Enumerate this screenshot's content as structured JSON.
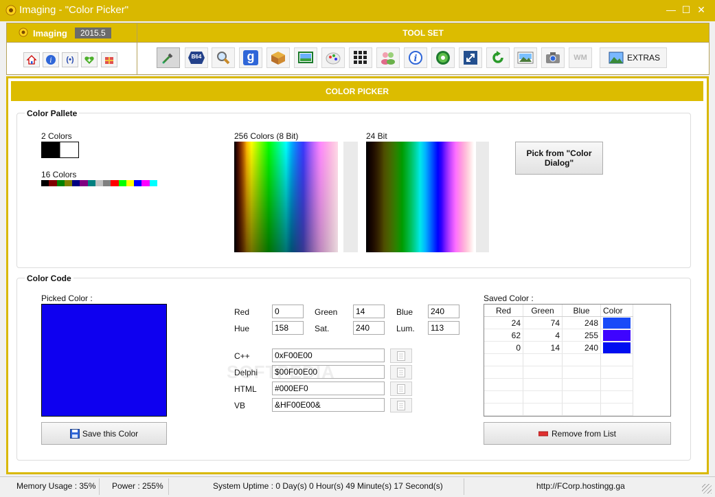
{
  "window": {
    "title": "Imaging - \"Color Picker\"",
    "controls": {
      "minimize": "—",
      "maximize": "☐",
      "close": "✕"
    }
  },
  "app": {
    "name": "Imaging",
    "version": "2015.5"
  },
  "toolset": {
    "title": "TOOL SET",
    "tools": [
      "eyedropper-icon",
      "base64-icon",
      "magnifier-icon",
      "google-icon",
      "box-icon",
      "images-icon",
      "paint-icon",
      "grid-icon",
      "people-icon",
      "info-icon",
      "gear-icon",
      "resize-icon",
      "refresh-icon",
      "picture-icon",
      "camera-icon",
      "watermark-icon"
    ],
    "b64_label": "B64",
    "g_label": "g",
    "wm_label": "WM",
    "extras_label": "EXTRAS"
  },
  "panel_title": "COLOR PICKER",
  "palette": {
    "group_label": "Color Pallete",
    "two_colors_label": "2 Colors",
    "sixteen_colors_label": "16 Colors",
    "sixteen_colors": [
      "#000000",
      "#800000",
      "#008000",
      "#808000",
      "#000080",
      "#800080",
      "#008080",
      "#c0c0c0",
      "#808080",
      "#ff0000",
      "#00ff00",
      "#ffff00",
      "#0000ff",
      "#ff00ff",
      "#00ffff",
      "#ffffff"
    ],
    "bit8_label": "256 Colors (8 Bit)",
    "bit24_label": "24 Bit",
    "pick_dialog_label": "Pick from \"Color Dialog\""
  },
  "color_code": {
    "group_label": "Color Code",
    "picked_label": "Picked Color :",
    "picked_color": "#0e00f0",
    "save_label": "Save this Color",
    "red_label": "Red",
    "red": "0",
    "green_label": "Green",
    "green": "14",
    "blue_label": "Blue",
    "blue": "240",
    "hue_label": "Hue",
    "hue": "158",
    "sat_label": "Sat.",
    "sat": "240",
    "lum_label": "Lum.",
    "lum": "113",
    "cpp_label": "C++",
    "cpp": "0xF00E00",
    "delphi_label": "Delphi",
    "delphi": "$00F00E00",
    "html_label": "HTML",
    "html": "#000EF0",
    "vb_label": "VB",
    "vb": "&HF00E00&"
  },
  "saved": {
    "label": "Saved Color :",
    "headers": [
      "Red",
      "Green",
      "Blue",
      "Color"
    ],
    "rows": [
      {
        "red": "24",
        "green": "74",
        "blue": "248",
        "color": "#184af8"
      },
      {
        "red": "62",
        "green": "4",
        "blue": "255",
        "color": "#3e04ff"
      },
      {
        "red": "0",
        "green": "14",
        "blue": "240",
        "color": "#000ef0"
      }
    ],
    "remove_label": "Remove from List"
  },
  "status": {
    "memory": "Memory Usage : 35%",
    "power": "Power : 255%",
    "uptime": "System Uptime : 0 Day(s) 0 Hour(s) 49 Minute(s) 17 Second(s)",
    "url": "http://FCorp.hostingg.ga"
  },
  "watermark": "SOFTPEDIA"
}
